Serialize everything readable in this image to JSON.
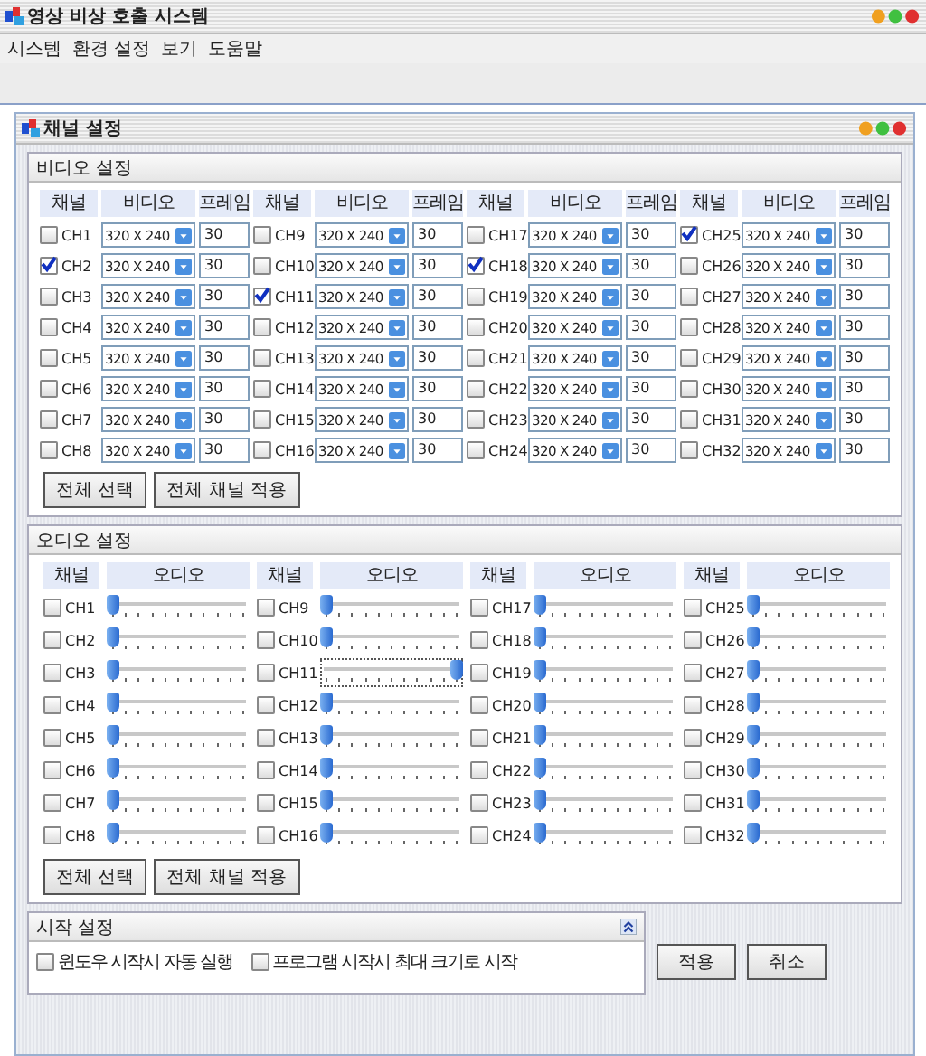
{
  "window": {
    "title": "영상 비상 호출 시스템"
  },
  "menu": [
    "시스템",
    "환경 설정",
    "보기",
    "도움말"
  ],
  "dialog": {
    "title": "채널 설정"
  },
  "video": {
    "title": "비디오 설정",
    "columns": [
      "채널",
      "비디오",
      "프레임",
      "채널",
      "비디오",
      "프레임",
      "채널",
      "비디오",
      "프레임",
      "채널",
      "비디오",
      "프레임"
    ],
    "channels": [
      {
        "name": "CH1",
        "checked": false,
        "resolution": "320 X 240",
        "frames": "30"
      },
      {
        "name": "CH2",
        "checked": true,
        "resolution": "320 X 240",
        "frames": "30"
      },
      {
        "name": "CH3",
        "checked": false,
        "resolution": "320 X 240",
        "frames": "30"
      },
      {
        "name": "CH4",
        "checked": false,
        "resolution": "320 X 240",
        "frames": "30"
      },
      {
        "name": "CH5",
        "checked": false,
        "resolution": "320 X 240",
        "frames": "30"
      },
      {
        "name": "CH6",
        "checked": false,
        "resolution": "320 X 240",
        "frames": "30"
      },
      {
        "name": "CH7",
        "checked": false,
        "resolution": "320 X 240",
        "frames": "30"
      },
      {
        "name": "CH8",
        "checked": false,
        "resolution": "320 X 240",
        "frames": "30"
      },
      {
        "name": "CH9",
        "checked": false,
        "resolution": "320 X 240",
        "frames": "30"
      },
      {
        "name": "CH10",
        "checked": false,
        "resolution": "320 X 240",
        "frames": "30"
      },
      {
        "name": "CH11",
        "checked": true,
        "resolution": "320 X 240",
        "frames": "30"
      },
      {
        "name": "CH12",
        "checked": false,
        "resolution": "320 X 240",
        "frames": "30"
      },
      {
        "name": "CH13",
        "checked": false,
        "resolution": "320 X 240",
        "frames": "30"
      },
      {
        "name": "CH14",
        "checked": false,
        "resolution": "320 X 240",
        "frames": "30"
      },
      {
        "name": "CH15",
        "checked": false,
        "resolution": "320 X 240",
        "frames": "30"
      },
      {
        "name": "CH16",
        "checked": false,
        "resolution": "320 X 240",
        "frames": "30"
      },
      {
        "name": "CH17",
        "checked": false,
        "resolution": "320 X 240",
        "frames": "30"
      },
      {
        "name": "CH18",
        "checked": true,
        "resolution": "320 X 240",
        "frames": "30"
      },
      {
        "name": "CH19",
        "checked": false,
        "resolution": "320 X 240",
        "frames": "30"
      },
      {
        "name": "CH20",
        "checked": false,
        "resolution": "320 X 240",
        "frames": "30"
      },
      {
        "name": "CH21",
        "checked": false,
        "resolution": "320 X 240",
        "frames": "30"
      },
      {
        "name": "CH22",
        "checked": false,
        "resolution": "320 X 240",
        "frames": "30"
      },
      {
        "name": "CH23",
        "checked": false,
        "resolution": "320 X 240",
        "frames": "30"
      },
      {
        "name": "CH24",
        "checked": false,
        "resolution": "320 X 240",
        "frames": "30"
      },
      {
        "name": "CH25",
        "checked": true,
        "resolution": "320 X 240",
        "frames": "30"
      },
      {
        "name": "CH26",
        "checked": false,
        "resolution": "320 X 240",
        "frames": "30"
      },
      {
        "name": "CH27",
        "checked": false,
        "resolution": "320 X 240",
        "frames": "30"
      },
      {
        "name": "CH28",
        "checked": false,
        "resolution": "320 X 240",
        "frames": "30"
      },
      {
        "name": "CH29",
        "checked": false,
        "resolution": "320 X 240",
        "frames": "30"
      },
      {
        "name": "CH30",
        "checked": false,
        "resolution": "320 X 240",
        "frames": "30"
      },
      {
        "name": "CH31",
        "checked": false,
        "resolution": "320 X 240",
        "frames": "30"
      },
      {
        "name": "CH32",
        "checked": false,
        "resolution": "320 X 240",
        "frames": "30"
      }
    ],
    "buttons": [
      "전체 선택",
      "전체 채널 적용"
    ]
  },
  "audio": {
    "title": "오디오 설정",
    "columns": [
      "채널",
      "오디오",
      "채널",
      "오디오",
      "채널",
      "오디오",
      "채널",
      "오디오"
    ],
    "channels": [
      {
        "name": "CH1",
        "checked": false,
        "level": 0
      },
      {
        "name": "CH2",
        "checked": false,
        "level": 0
      },
      {
        "name": "CH3",
        "checked": false,
        "level": 0
      },
      {
        "name": "CH4",
        "checked": false,
        "level": 0
      },
      {
        "name": "CH5",
        "checked": false,
        "level": 0
      },
      {
        "name": "CH6",
        "checked": false,
        "level": 0
      },
      {
        "name": "CH7",
        "checked": false,
        "level": 0
      },
      {
        "name": "CH8",
        "checked": false,
        "level": 0
      },
      {
        "name": "CH9",
        "checked": false,
        "level": 0
      },
      {
        "name": "CH10",
        "checked": false,
        "level": 0
      },
      {
        "name": "CH11",
        "checked": false,
        "level": 1,
        "focused": true
      },
      {
        "name": "CH12",
        "checked": false,
        "level": 0
      },
      {
        "name": "CH13",
        "checked": false,
        "level": 0
      },
      {
        "name": "CH14",
        "checked": false,
        "level": 0
      },
      {
        "name": "CH15",
        "checked": false,
        "level": 0
      },
      {
        "name": "CH16",
        "checked": false,
        "level": 0
      },
      {
        "name": "CH17",
        "checked": false,
        "level": 0
      },
      {
        "name": "CH18",
        "checked": false,
        "level": 0
      },
      {
        "name": "CH19",
        "checked": false,
        "level": 0
      },
      {
        "name": "CH20",
        "checked": false,
        "level": 0
      },
      {
        "name": "CH21",
        "checked": false,
        "level": 0
      },
      {
        "name": "CH22",
        "checked": false,
        "level": 0
      },
      {
        "name": "CH23",
        "checked": false,
        "level": 0
      },
      {
        "name": "CH24",
        "checked": false,
        "level": 0
      },
      {
        "name": "CH25",
        "checked": false,
        "level": 0
      },
      {
        "name": "CH26",
        "checked": false,
        "level": 0
      },
      {
        "name": "CH27",
        "checked": false,
        "level": 0
      },
      {
        "name": "CH28",
        "checked": false,
        "level": 0
      },
      {
        "name": "CH29",
        "checked": false,
        "level": 0
      },
      {
        "name": "CH30",
        "checked": false,
        "level": 0
      },
      {
        "name": "CH31",
        "checked": false,
        "level": 0
      },
      {
        "name": "CH32",
        "checked": false,
        "level": 0
      }
    ],
    "buttons": [
      "전체 선택",
      "전체 채널 적용"
    ]
  },
  "startup": {
    "title": "시작 설정",
    "expanded": true,
    "options": [
      {
        "label": "윈도우 시작시 자동 실행",
        "checked": false
      },
      {
        "label": "프로그램 시작시 최대 크기로 시작",
        "checked": false
      }
    ]
  },
  "buttons": [
    "적용",
    "취소"
  ]
}
